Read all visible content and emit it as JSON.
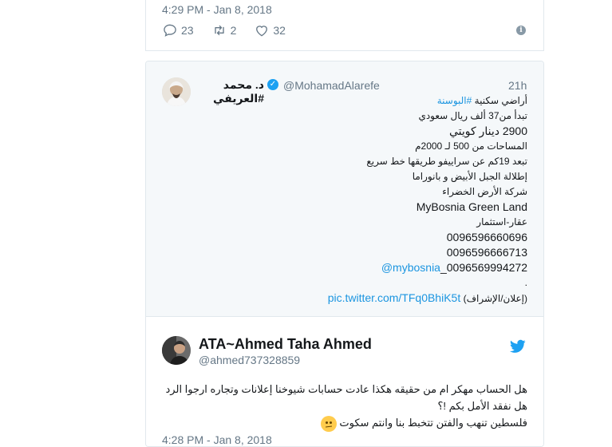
{
  "top_tweet": {
    "timestamp": "4:29 PM - Jan 8, 2018",
    "replies": "23",
    "retweets": "2",
    "likes": "32"
  },
  "quoted_tweet": {
    "age": "21h",
    "handle": "@MohamadAlarefe",
    "name": "د. محمد #العريفي",
    "lines": [
      {
        "pre": "أراضي سكنية ",
        "hash": "#البوسنة"
      },
      {
        "text": "تبدأ من37 ألف ريال سعودي"
      },
      {
        "text": "2900 دينار كويتي"
      },
      {
        "text": "المساحات من 500 لـ 2000م"
      },
      {
        "text": "تبعد 19كم عن سراييفو طريقها خط سريع"
      },
      {
        "text": "إطلالة الجبل الأبيض و بانوراما"
      },
      {
        "text": "شركة الأرض الخضراء"
      },
      {
        "text": "MyBosnia Green Land"
      },
      {
        "text": "عقار-استثمار"
      },
      {
        "text": "0096596660696"
      },
      {
        "text": "0096596666713"
      },
      {
        "mention": "@mybosnia",
        "text": "_0096569994272"
      },
      {
        "text": "."
      },
      {
        "pre": "(إعلان/الإشراف) ",
        "link": "pic.twitter.com/TFq0BhiK5t"
      }
    ]
  },
  "reply_tweet": {
    "name": "ATA~Ahmed Taha Ahmed",
    "handle": "@ahmed737328859",
    "lines": [
      "هل الحساب مهكر ام من حقيقه هكذا عادت حسابات شيوخنا إعلانات وتجاره ارجوا الرد",
      "هل نفقد الأمل بكم !؟",
      "فلسطين تنهب والفتن تتخبط بنا وانتم سكوت"
    ],
    "timestamp": "4:28 PM - Jan 8, 2018"
  },
  "colors": {
    "accent": "#1da1f2",
    "link": "#1b95e0",
    "muted": "#657786",
    "border": "#e1e8ed",
    "quoted_bg": "#f5f8fa"
  }
}
